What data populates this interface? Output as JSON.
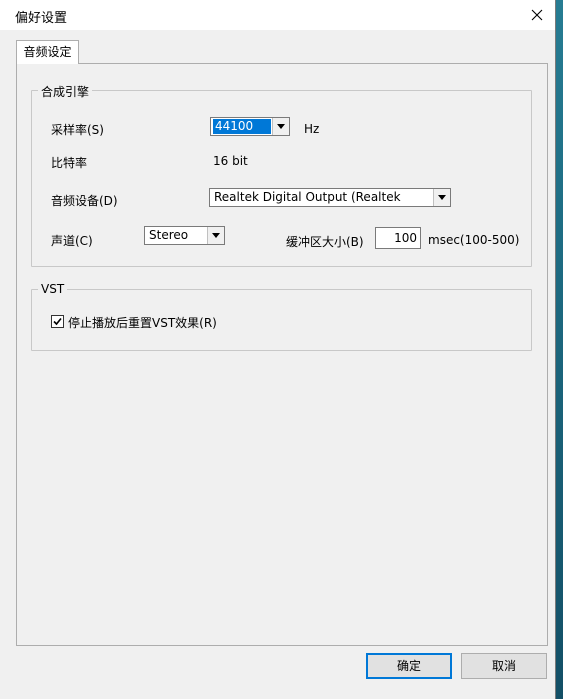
{
  "window": {
    "title": "偏好设置"
  },
  "tabs": [
    {
      "label": "音频设定"
    }
  ],
  "synth_group": {
    "legend": "合成引擎",
    "sample_rate": {
      "label": "采样率(S)",
      "value": "44100",
      "unit": "Hz"
    },
    "bit_rate": {
      "label": "比特率",
      "value": "16 bit"
    },
    "audio_device": {
      "label": "音频设备(D)",
      "value": "Realtek Digital Output (Realtek"
    },
    "channel": {
      "label": "声道(C)",
      "value": "Stereo"
    },
    "buffer": {
      "label": "缓冲区大小(B)",
      "value": "100",
      "unit": "msec(100-500)"
    }
  },
  "vst_group": {
    "legend": "VST",
    "reset_checkbox": {
      "label": "停止播放后重置VST效果(R)",
      "checked": true
    }
  },
  "buttons": {
    "ok": "确定",
    "cancel": "取消"
  },
  "colors": {
    "selection": "#0078d7",
    "dialog_bg": "#f0f0f0"
  }
}
